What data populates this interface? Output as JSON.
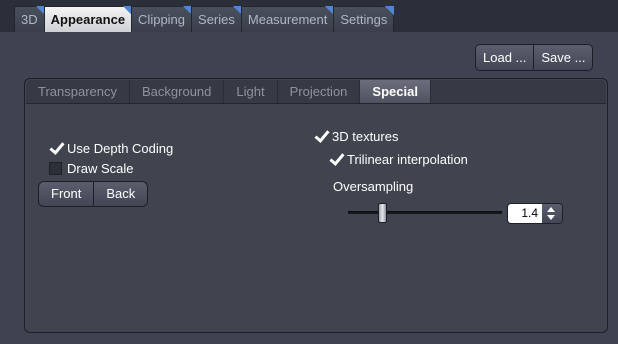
{
  "top_tabs": [
    {
      "label": "3D",
      "marker": true
    },
    {
      "label": "Appearance",
      "marker": true,
      "active": true
    },
    {
      "label": "Clipping",
      "marker": true
    },
    {
      "label": "Series",
      "marker": true
    },
    {
      "label": "Measurement",
      "marker": true
    },
    {
      "label": "Settings",
      "marker": true
    }
  ],
  "toolbar": {
    "load_label": "Load ...",
    "save_label": "Save ..."
  },
  "sub_tabs": [
    {
      "label": "Transparency"
    },
    {
      "label": "Background"
    },
    {
      "label": "Light"
    },
    {
      "label": "Projection"
    },
    {
      "label": "Special",
      "active": true
    }
  ],
  "special": {
    "use_depth_coding": {
      "label": "Use Depth Coding",
      "checked": true
    },
    "draw_scale": {
      "label": "Draw Scale",
      "checked": false
    },
    "front_label": "Front",
    "back_label": "Back",
    "textures_3d": {
      "label": "3D textures",
      "checked": true
    },
    "trilinear": {
      "label": "Trilinear interpolation",
      "checked": true
    },
    "oversampling_label": "Oversampling",
    "oversampling_value": "1.4"
  },
  "colors": {
    "accent_marker": "#4e86d8",
    "background": "#3f4351",
    "active_tab": "#e0e0e0"
  }
}
